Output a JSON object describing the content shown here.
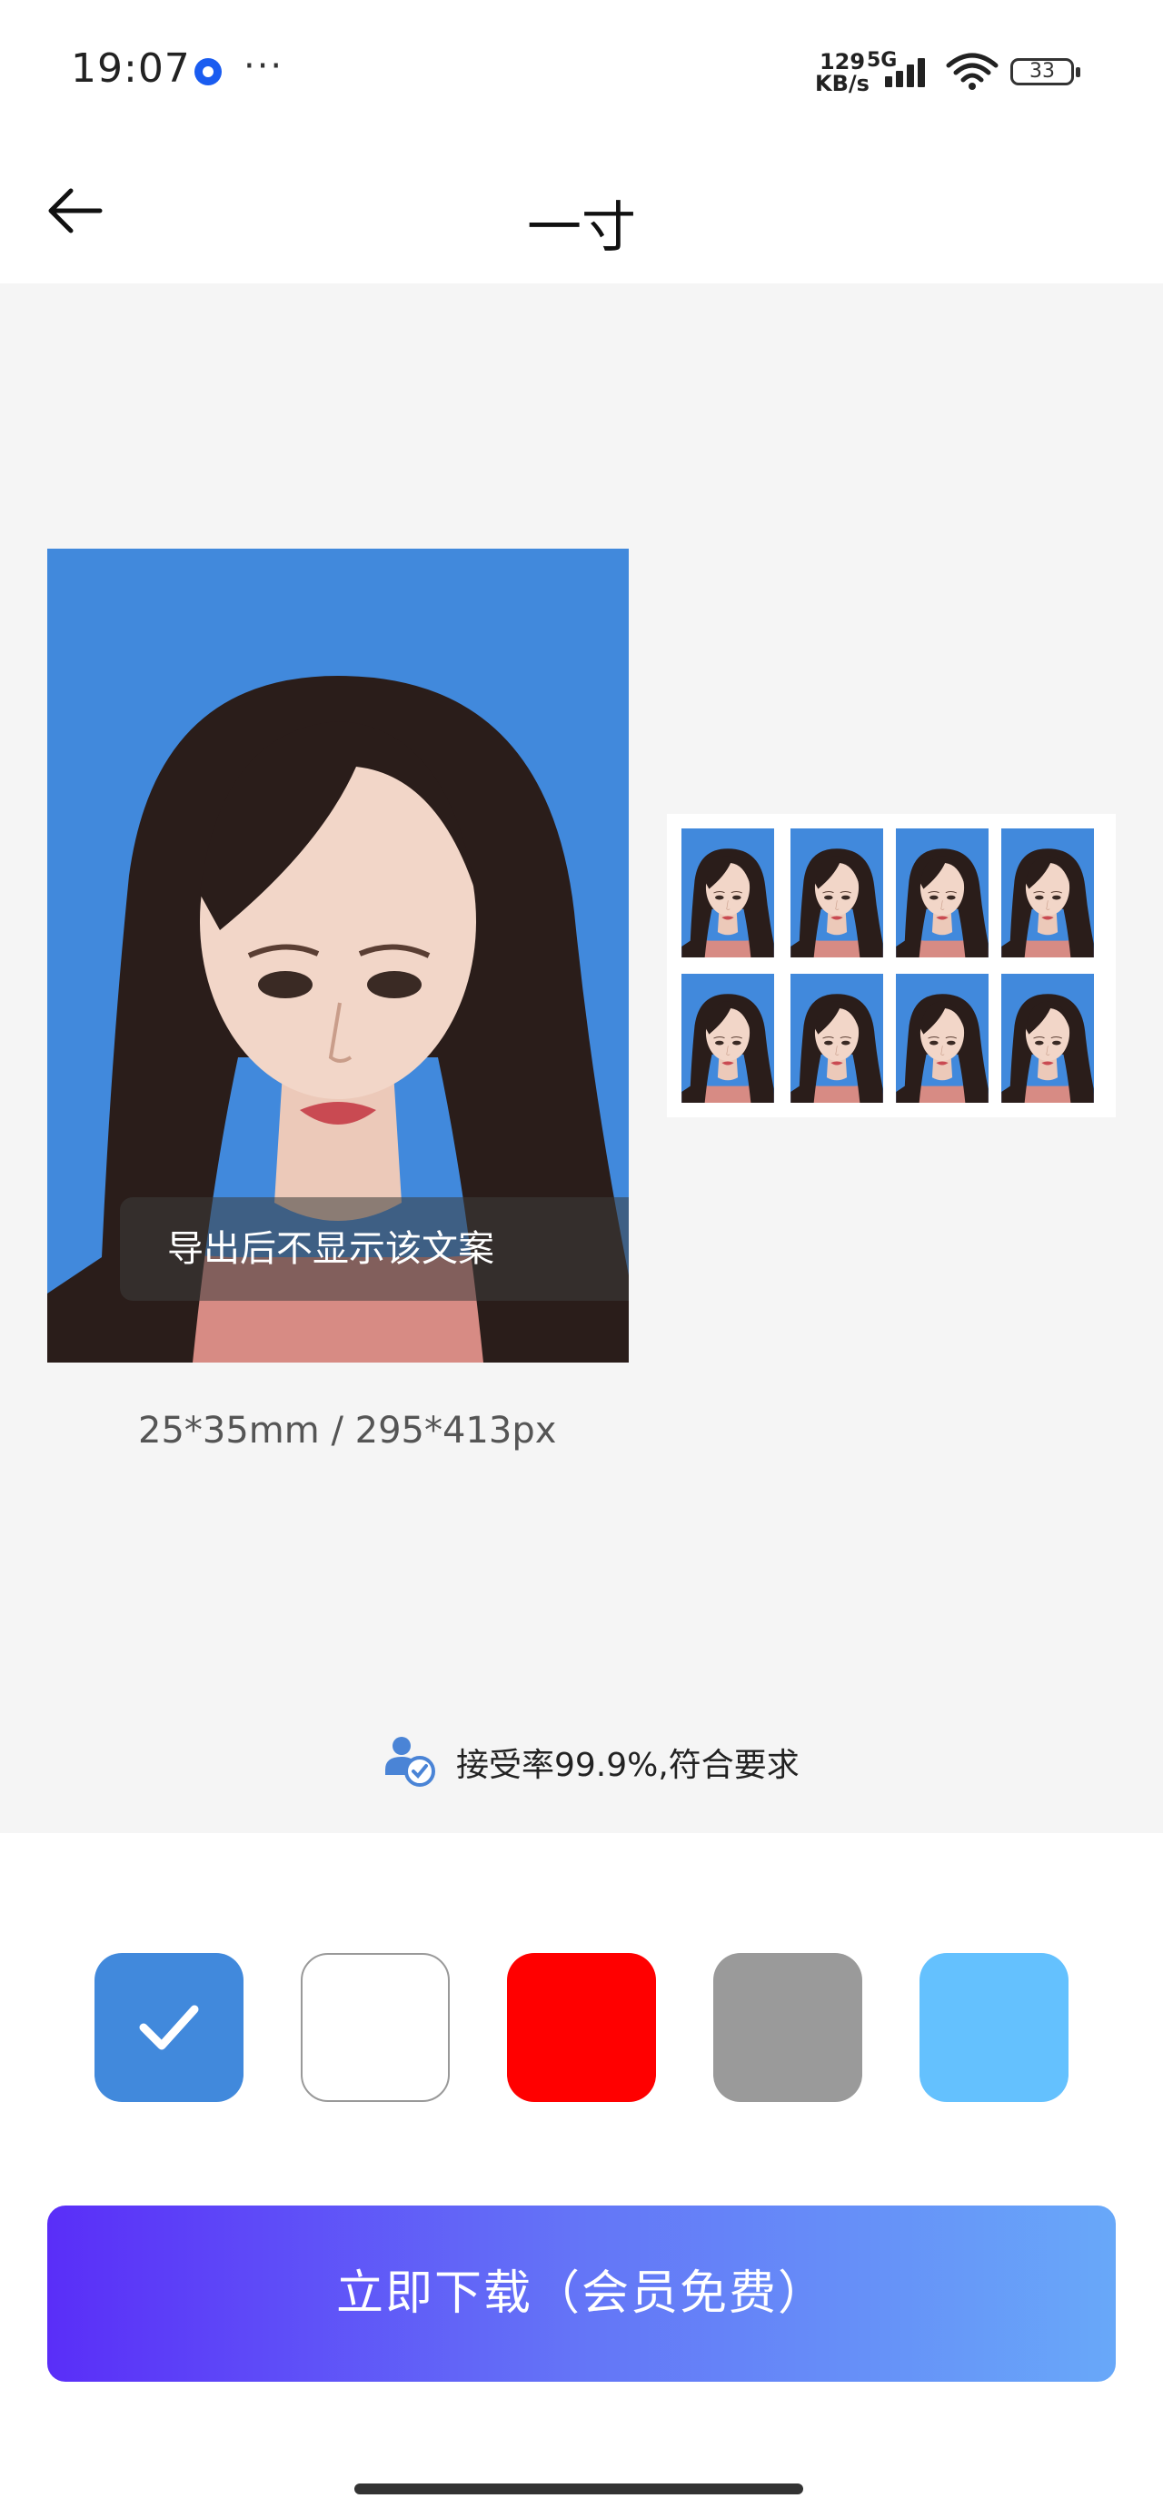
{
  "status_bar": {
    "time": "19:07",
    "net_speed_value": "129",
    "net_speed_unit": "KB/s",
    "network": "5G",
    "battery": "33",
    "icons": [
      "app-notification-icon",
      "more-dots-icon",
      "signal-icon",
      "wifi-icon",
      "battery-icon"
    ]
  },
  "header": {
    "title": "一寸",
    "back_icon": "arrow-left-icon"
  },
  "preview": {
    "watermark_text": "导出后不显示该文案",
    "size_text": "25*35mm / 295*413px",
    "accept_text": "接受率99.9%,符合要求",
    "accept_icon": "person-check-icon"
  },
  "colors": {
    "options": [
      {
        "name": "blue",
        "hex": "#4189dc",
        "selected": true
      },
      {
        "name": "white",
        "hex": "#ffffff",
        "selected": false
      },
      {
        "name": "red",
        "hex": "#ff0000",
        "selected": false
      },
      {
        "name": "gray",
        "hex": "#9a9a9a",
        "selected": false
      },
      {
        "name": "light-blue",
        "hex": "#64c1fe",
        "selected": false
      }
    ]
  },
  "download": {
    "label": "立即下载（会员免费）"
  }
}
